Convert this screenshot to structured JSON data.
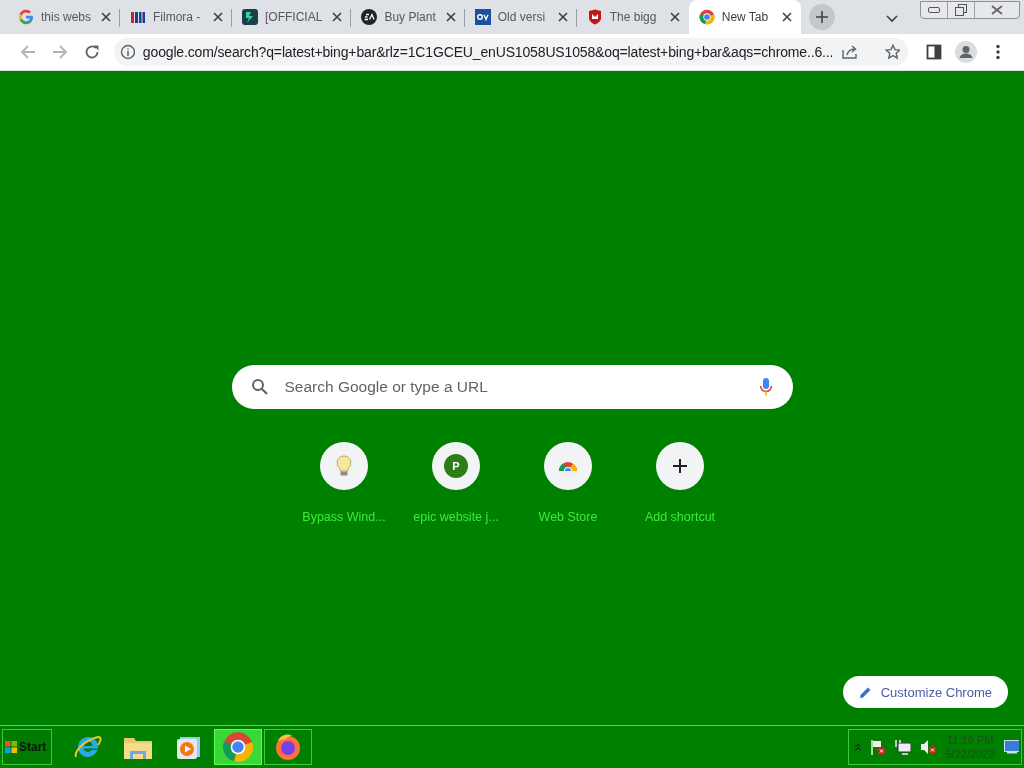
{
  "tabs": [
    {
      "title": "this webs",
      "kind": "google",
      "selected": false
    },
    {
      "title": "Filmora -",
      "kind": "bars",
      "selected": false
    },
    {
      "title": "[OFFICIAL",
      "kind": "filmora",
      "selected": false
    },
    {
      "title": "Buy Plant",
      "kind": "ea",
      "selected": false
    },
    {
      "title": "Old versi",
      "kind": "ov",
      "selected": false
    },
    {
      "title": "The bigg",
      "kind": "shield",
      "selected": false
    },
    {
      "title": "New Tab",
      "kind": "chrome",
      "selected": true
    }
  ],
  "address_bar": {
    "url": "google.com/search?q=latest+bing+bar&rlz=1C1GCEU_enUS1058US1058&oq=latest+bing+bar&aqs=chrome..6..."
  },
  "search": {
    "placeholder": "Search Google or type a URL"
  },
  "shortcuts": [
    {
      "label": "Bypass Wind...",
      "kind": "bulb"
    },
    {
      "label": "epic website j...",
      "kind": "letter",
      "letter": "P"
    },
    {
      "label": "Web Store",
      "kind": "webstore"
    },
    {
      "label": "Add shortcut",
      "kind": "add"
    }
  ],
  "customize_button": {
    "label": "Customize Chrome"
  },
  "taskbar": {
    "start": "Start",
    "apps": [
      {
        "kind": "ie",
        "selected": false
      },
      {
        "kind": "folder",
        "selected": false
      },
      {
        "kind": "media",
        "selected": false
      },
      {
        "kind": "chrome",
        "selected": true
      },
      {
        "kind": "firefox",
        "selected": false
      }
    ],
    "time": "11:19 PM",
    "date": "5/22/2023"
  }
}
